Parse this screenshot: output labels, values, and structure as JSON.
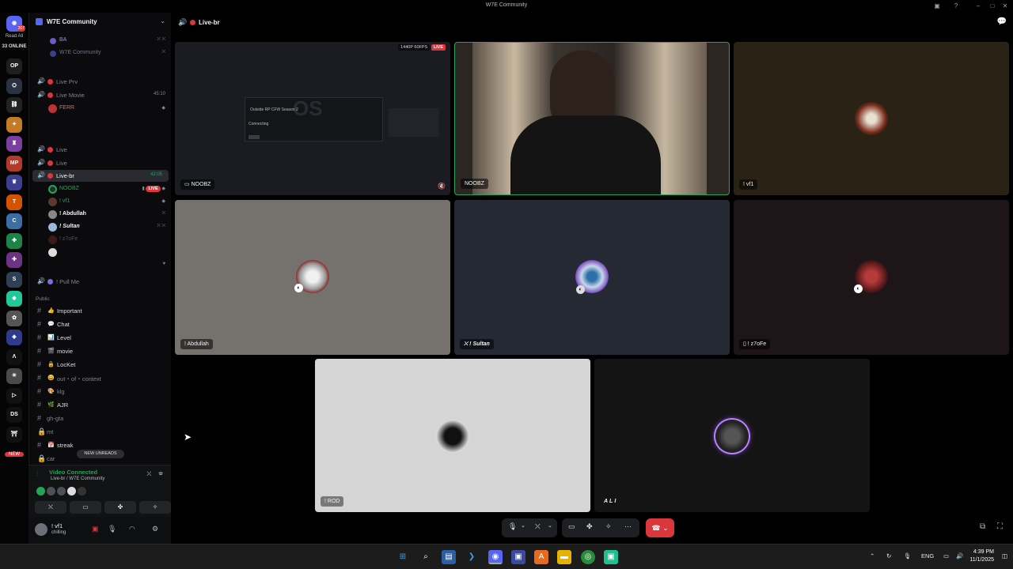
{
  "window": {
    "title": "W7E Community"
  },
  "rail": {
    "home_badge": "207",
    "read_all": "Read All",
    "online": "33 ONLINE",
    "new_label": "NEW",
    "servers": [
      {
        "label": "OP",
        "color": "#1f1f1f"
      },
      {
        "label": "⛭",
        "color": "#2a3140"
      },
      {
        "label": "⛓",
        "color": "#222"
      },
      {
        "label": "✦",
        "color": "#c57a24"
      },
      {
        "label": "♜",
        "color": "#7b3fa0"
      },
      {
        "label": "MP",
        "color": "#b03a2e"
      },
      {
        "label": "♛",
        "color": "#3e3e8f"
      },
      {
        "label": "T",
        "color": "#d35400"
      },
      {
        "label": "C",
        "color": "#3a6ea5"
      },
      {
        "label": "✤",
        "color": "#1d8348"
      },
      {
        "label": "✚",
        "color": "#6c3483"
      },
      {
        "label": "S",
        "color": "#2e4053"
      },
      {
        "label": "◆",
        "color": "#20c997"
      },
      {
        "label": "✿",
        "color": "#555"
      },
      {
        "label": "◈",
        "color": "#2e3a8c"
      },
      {
        "label": "Λ",
        "color": "#111"
      },
      {
        "label": "☀",
        "color": "#4a4a4a"
      },
      {
        "label": "▷",
        "color": "#111"
      },
      {
        "label": "DS",
        "color": "#111"
      },
      {
        "label": "⛩",
        "color": "#111"
      }
    ]
  },
  "sidebar": {
    "server_name": "W7E Community",
    "voice_channels": [
      {
        "label": "BA",
        "sub": true
      },
      {
        "label": "W7E Community",
        "sub": true
      },
      {
        "label": "Live Prv"
      },
      {
        "label": "Live Movie",
        "time": "45:10"
      },
      {
        "label": "FERR",
        "sub": true
      },
      {
        "label": "Live"
      },
      {
        "label": "Live"
      },
      {
        "label": "Live-br",
        "time": "42:05",
        "active": true
      }
    ],
    "members": [
      {
        "name": "NOOBZ",
        "live": "LIVE"
      },
      {
        "name": "! vf1"
      },
      {
        "name": "! Abdullah"
      },
      {
        "name": "! Sultan"
      },
      {
        "name": "! z7oFe"
      }
    ],
    "pull_me": "! Pull Me",
    "category": "Public",
    "text_channels": [
      {
        "emoji": "👍",
        "label": "Important"
      },
      {
        "emoji": "💬",
        "label": "Chat"
      },
      {
        "emoji": "📊",
        "label": "Level"
      },
      {
        "emoji": "🎬",
        "label": "movie"
      },
      {
        "emoji": "🔒",
        "label": "LocKet"
      },
      {
        "emoji": "😄",
        "label": "out・of・context"
      },
      {
        "emoji": "🎨",
        "label": "klg"
      },
      {
        "emoji": "🌿",
        "label": "AJR"
      },
      {
        "emoji": "",
        "label": "gh-gta"
      },
      {
        "emoji": "",
        "label": "mt"
      },
      {
        "emoji": "📅",
        "label": "streak"
      },
      {
        "emoji": "",
        "label": "car"
      }
    ],
    "new_unreads": "NEW UNREADS"
  },
  "voice_panel": {
    "status": "Video Connected",
    "path": "Live-br / W7E Community"
  },
  "user_panel": {
    "name": "! vf1",
    "status": "chilling"
  },
  "channel": {
    "name": "Live-br"
  },
  "stream": {
    "quality": "1440P 60FPS",
    "live": "LIVE",
    "dialog_title": "Outside RP CFW Season 2",
    "dialog_status": "Connecting",
    "watermark": "OS"
  },
  "tiles": [
    {
      "name": "NOOBZ"
    },
    {
      "name": "NOOBZ"
    },
    {
      "name": "! vf1"
    },
    {
      "name": "! Abdullah"
    },
    {
      "name": "! Sultan"
    },
    {
      "name": "! z7oFe"
    },
    {
      "name": "! ROD"
    },
    {
      "name": "ALI"
    }
  ],
  "taskbar": {
    "lang": "ENG",
    "time": "4:39 PM",
    "date": "11/1/2025"
  }
}
